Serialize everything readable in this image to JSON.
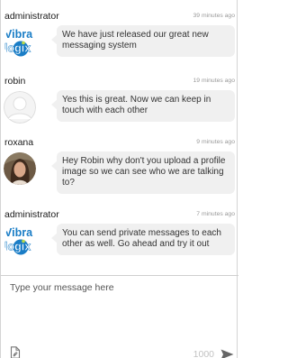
{
  "messages": [
    {
      "author": "administrator",
      "time": "39 minutes ago",
      "text": "We have just released our great new messaging system",
      "avatar": "vibralogix-logo"
    },
    {
      "author": "robin",
      "time": "19 minutes ago",
      "text": "Yes this is great. Now we can keep in touch with each other",
      "avatar": "default-user-silhouette"
    },
    {
      "author": "roxana",
      "time": "9 minutes ago",
      "text": "Hey Robin why don't you upload a profile image so we can see who we are talking to?",
      "avatar": "user-photo"
    },
    {
      "author": "administrator",
      "time": "7 minutes ago",
      "text": "You can send private messages to each other as well. Go ahead and try it out",
      "avatar": "vibralogix-logo"
    }
  ],
  "composer": {
    "placeholder": "Type your message here",
    "char_limit": "1000",
    "attach_icon": "attach-file-icon",
    "send_icon": "send-icon"
  },
  "logo": {
    "line1": "Vibra",
    "line2": "logix"
  },
  "colors": {
    "bubble": "#f0f0f0",
    "logo_blue": "#1a7dc6",
    "logo_text": "#ffffff",
    "timestamp": "#9a9a9a"
  }
}
